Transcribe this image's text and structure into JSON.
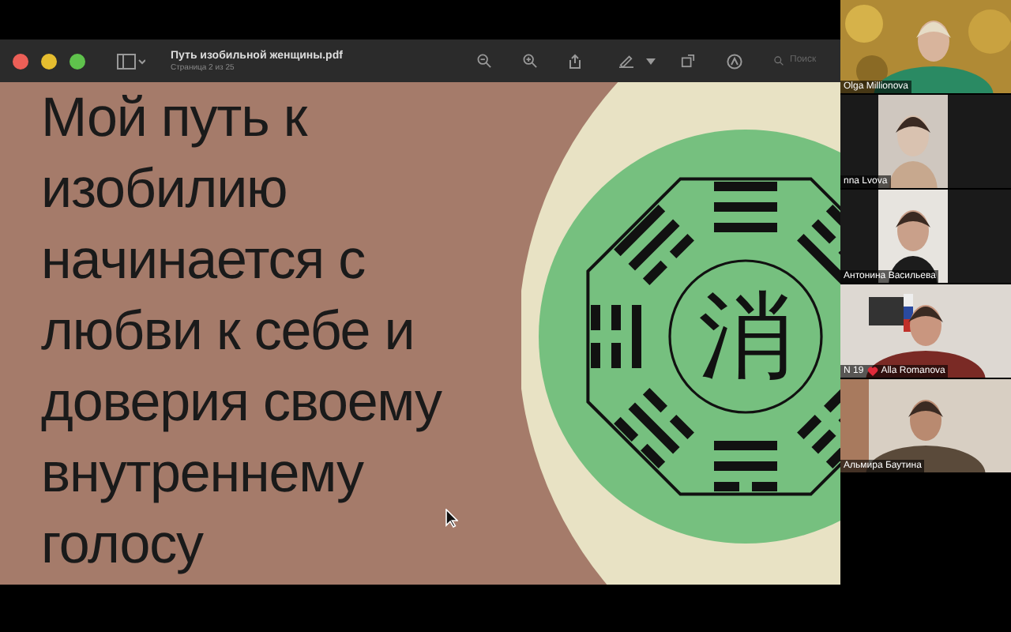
{
  "viewer": {
    "title": "Путь изобильной женщины.pdf",
    "subtitle": "Страница 2 из 25",
    "search": {
      "placeholder": "Поиск"
    }
  },
  "slide": {
    "heading_lines": [
      "Мой путь к",
      "изобилию",
      "начинается с",
      "любви к себе и",
      "доверия своему",
      "внутреннему",
      "голосу"
    ],
    "center_character": "消"
  },
  "participants": [
    {
      "name": "Olga Millionova",
      "kind": "full",
      "heart": false
    },
    {
      "name": "nna Lvova",
      "kind": "portrait",
      "heart": false
    },
    {
      "name": "Антонина Васильева",
      "kind": "portrait",
      "heart": false
    },
    {
      "name": "N 19",
      "name2": "Alla Romanova",
      "kind": "full",
      "heart": true
    },
    {
      "name": "Альмира Баутина",
      "kind": "full",
      "heart": false
    }
  ]
}
